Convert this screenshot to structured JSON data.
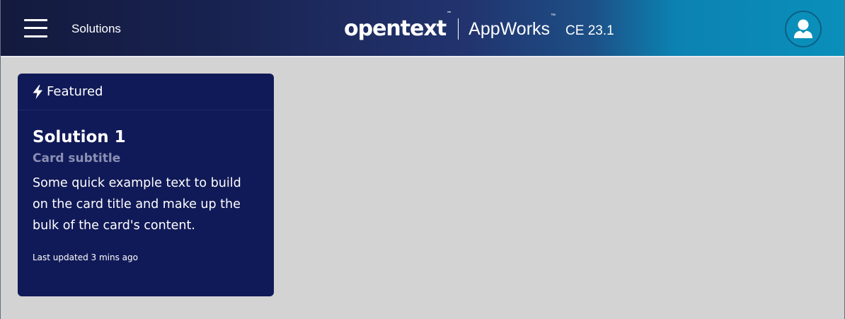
{
  "header": {
    "nav_title": "Solutions",
    "brand_logo": "opentext",
    "brand_logo_tm": "™",
    "brand_product": "AppWorks",
    "brand_product_tm": "™",
    "brand_version": "CE 23.1",
    "menu_icon": "hamburger-menu-icon",
    "user_icon": "user-avatar-icon"
  },
  "card": {
    "header_icon": "lightning-bolt-icon",
    "header_label": "Featured",
    "title": "Solution 1",
    "subtitle": "Card subtitle",
    "text": "Some quick example text to build on the card title and make up the bulk of the card's content.",
    "footer": "Last updated 3 mins ago"
  },
  "colors": {
    "page_background": "#d3d3d3",
    "card_background": "#111a58",
    "header_gradient_start": "#141a3e",
    "header_gradient_end": "#0a8fba",
    "subtitle_text": "#8a90b4"
  }
}
